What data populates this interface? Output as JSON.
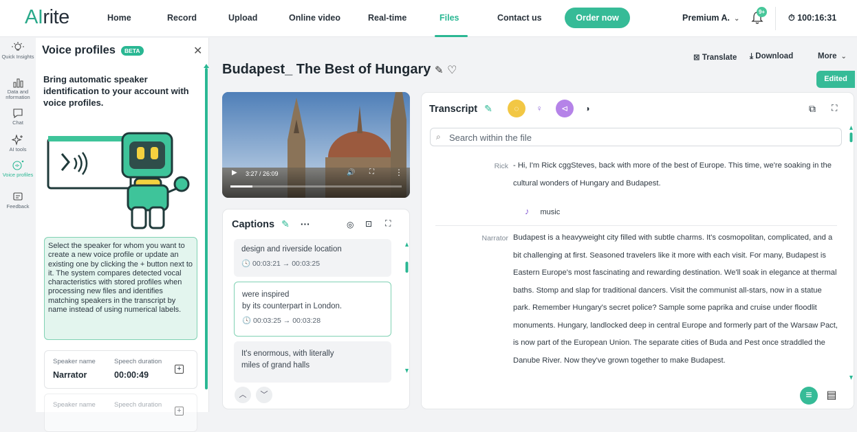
{
  "brand": {
    "logo_ai": "AI",
    "logo_rest": "rite",
    "accent": "#2ab793"
  },
  "nav": {
    "items": [
      "Home",
      "Record",
      "Upload",
      "Online video",
      "Real-time",
      "Files",
      "Contact us"
    ],
    "active": "Files",
    "order_label": "Order now",
    "account_label": "Premium A.",
    "notification_count": "9+",
    "timer": "100:16:31"
  },
  "rail": {
    "items": [
      {
        "label": "Quick Insights",
        "icon": "bulb-icon"
      },
      {
        "label": "Data and nformation",
        "icon": "chart-icon"
      },
      {
        "label": "Chat",
        "icon": "chat-icon"
      },
      {
        "label": "AI tools",
        "icon": "sparkle-icon"
      },
      {
        "label": "Voice profiles",
        "icon": "voice-profile-icon"
      },
      {
        "label": "Feedback",
        "icon": "feedback-icon"
      }
    ]
  },
  "voice_panel": {
    "title": "Voice profiles",
    "badge": "BETA",
    "heading": "Bring automatic speaker identification to your account with voice profiles.",
    "info": "Select the speaker for whom you want to create a new voice profile or update an existing one by clicking the + button next to it. The system compares detected vocal characteristics with stored profiles when processing new files and identifies matching speakers in the transcript by name instead of using numerical labels.",
    "speakers": [
      {
        "name_label": "Speaker name",
        "duration_label": "Speech duration",
        "name": "Narrator",
        "duration": "00:00:49"
      },
      {
        "name_label": "Speaker name",
        "duration_label": "Speech duration",
        "name": "",
        "duration": ""
      }
    ]
  },
  "file": {
    "title": "Budapest_ The Best of Hungary",
    "actions": {
      "translate": "Translate",
      "download": "Download",
      "more": "More"
    },
    "status": "Edited"
  },
  "video": {
    "time": "3:27 / 26:09",
    "progress": 0.13
  },
  "captions": {
    "title": "Captions",
    "items": [
      {
        "text": "design and riverside location",
        "time": "00:03:21 → 00:03:25",
        "active": false
      },
      {
        "text": "were inspired\nby its counterpart in London.",
        "time": "00:03:25 → 00:03:28",
        "active": true
      },
      {
        "text": "It's enormous, with literally\nmiles of grand halls",
        "time": "",
        "active": false
      }
    ]
  },
  "transcript": {
    "title": "Transcript",
    "search_placeholder": "Search within the file",
    "segments": [
      {
        "speaker": "Rick",
        "text": "- Hi, I'm Rick cggSteves, back with more of the best of Europe. This time, we're soaking in the cultural wonders of Hungary and Budapest."
      },
      {
        "speaker": "Narrator",
        "text": "Budapest is a heavyweight city filled with subtle charms. It's cosmopolitan, complicated, and a bit challenging at first. Seasoned travelers like it more with each visit. For many, Budapest is Eastern Europe's most fascinating and rewarding destination. We'll soak in elegance at thermal baths. Stomp and slap for traditional dancers. Visit the communist all-stars, now in a statue park. Remember Hungary's secret police? Sample some paprika and cruise under floodlit monuments. Hungary, landlocked deep in central Europe and formerly part of the Warsaw Pact, is now part of the European Union. The separate cities of Buda and Pest once straddled the Danube River. Now they've grown together to make Budapest."
      }
    ],
    "music_label": "music"
  }
}
